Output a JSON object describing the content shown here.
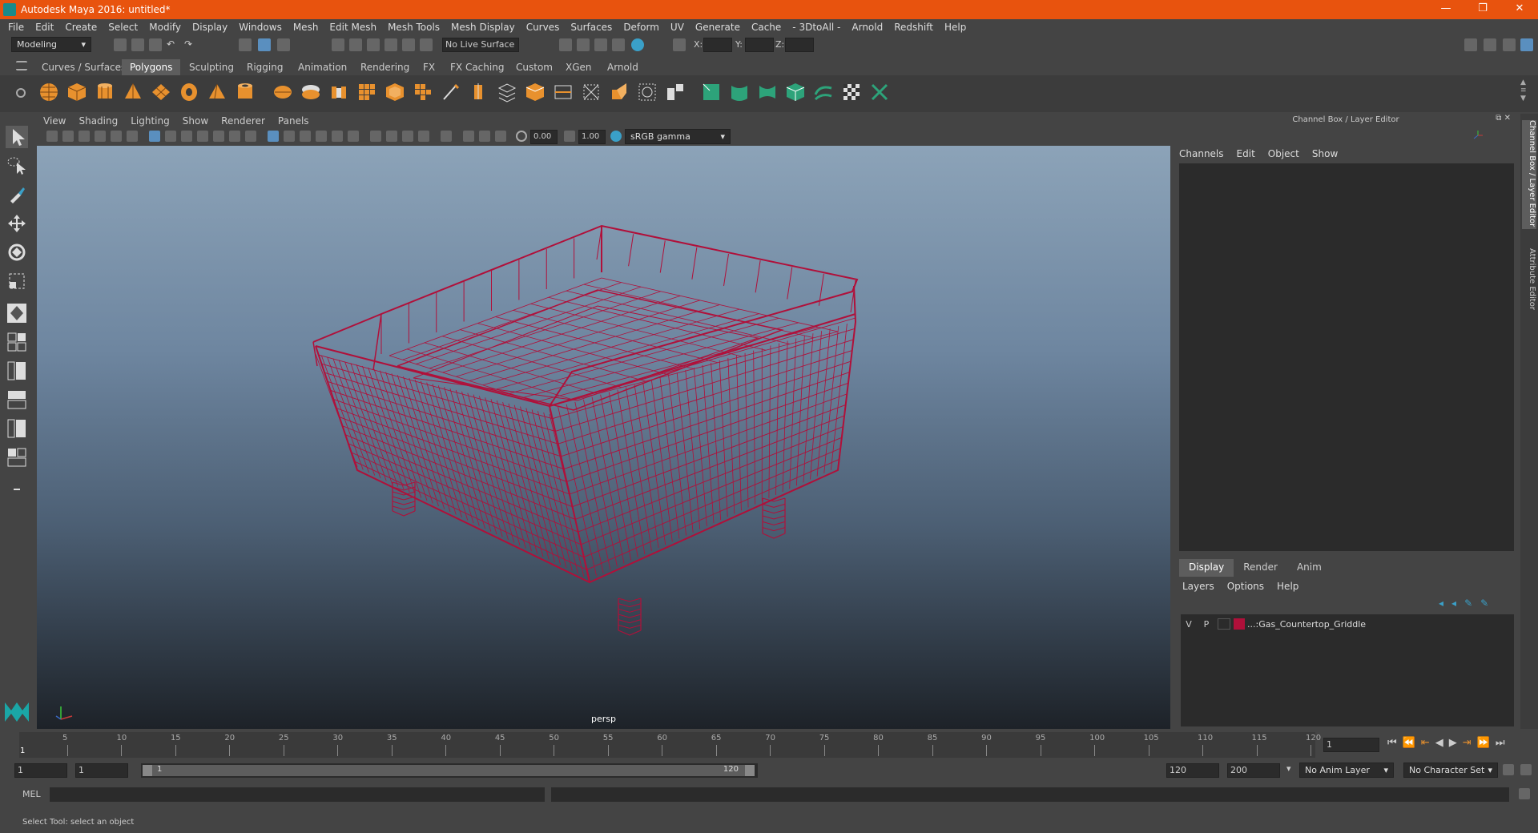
{
  "window": {
    "title": "Autodesk Maya 2016: untitled*",
    "minimize": "—",
    "restore": "❐",
    "close": "✕"
  },
  "menubar": [
    "File",
    "Edit",
    "Create",
    "Select",
    "Modify",
    "Display",
    "Windows",
    "Mesh",
    "Edit Mesh",
    "Mesh Tools",
    "Mesh Display",
    "Curves",
    "Surfaces",
    "Deform",
    "UV",
    "Generate",
    "Cache",
    "- 3DtoAll -",
    "Arnold",
    "Redshift",
    "Help"
  ],
  "status_line": {
    "mode": "Modeling",
    "live_surface": "No Live Surface",
    "x_label": "X:",
    "y_label": "Y:",
    "z_label": "Z:"
  },
  "shelf_tabs": [
    "Curves / Surfaces",
    "Polygons",
    "Sculpting",
    "Rigging",
    "Animation",
    "Rendering",
    "FX",
    "FX Caching",
    "Custom",
    "XGen",
    "Arnold"
  ],
  "active_shelf_tab": "Polygons",
  "viewport": {
    "menu": [
      "View",
      "Shading",
      "Lighting",
      "Show",
      "Renderer",
      "Panels"
    ],
    "exposure": "0.00",
    "gamma": "1.00",
    "color_space": "sRGB gamma",
    "camera_label": "persp",
    "wire_color": "#b0103a"
  },
  "channel_box": {
    "title": "Channel Box / Layer Editor",
    "menu": [
      "Channels",
      "Edit",
      "Object",
      "Show"
    ]
  },
  "layer_editor": {
    "tabs": [
      "Display",
      "Render",
      "Anim"
    ],
    "active_tab": "Display",
    "menu": [
      "Layers",
      "Options",
      "Help"
    ],
    "layers": [
      {
        "v": "V",
        "p": "P",
        "color": "#b0103a",
        "name": "...:Gas_Countertop_Griddle"
      }
    ]
  },
  "side_tabs": [
    "Channel Box / Layer Editor",
    "Attribute Editor"
  ],
  "timeline": {
    "ticks": [
      "5",
      "10",
      "15",
      "20",
      "25",
      "30",
      "35",
      "40",
      "45",
      "50",
      "55",
      "60",
      "65",
      "70",
      "75",
      "80",
      "85",
      "90",
      "95",
      "100",
      "105",
      "110",
      "115",
      "120"
    ],
    "current_frame_marker": "1",
    "current_frame": "1"
  },
  "range_slider": {
    "start": "1",
    "playback_start": "1",
    "range_start_label": "1",
    "range_end_label": "120",
    "playback_end": "120",
    "end": "200",
    "anim_layer": "No Anim Layer",
    "character_set": "No Character Set"
  },
  "command_line": {
    "label": "MEL"
  },
  "help_line": {
    "text": "Select Tool: select an object"
  }
}
